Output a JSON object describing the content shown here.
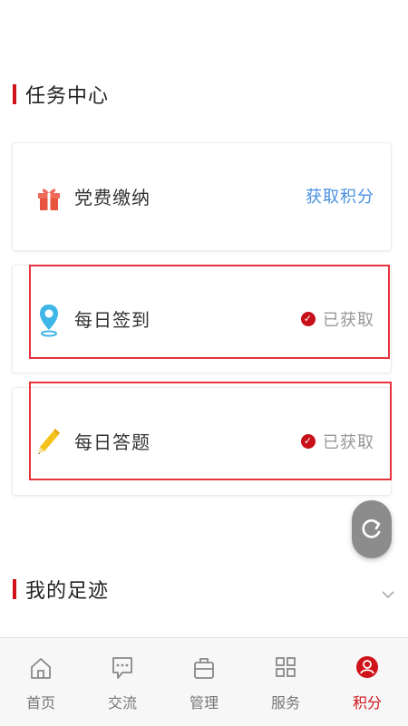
{
  "tasks": {
    "title": "任务中心",
    "items": [
      {
        "label": "党费缴纳",
        "action": "获取积分"
      },
      {
        "label": "每日签到",
        "status": "已获取"
      },
      {
        "label": "每日答题",
        "status": "已获取"
      }
    ]
  },
  "footprint": {
    "title": "我的足迹"
  },
  "tabbar": {
    "items": [
      {
        "label": "首页",
        "icon": "home-icon"
      },
      {
        "label": "交流",
        "icon": "chat-icon"
      },
      {
        "label": "管理",
        "icon": "briefcase-icon"
      },
      {
        "label": "服务",
        "icon": "grid-icon"
      },
      {
        "label": "积分",
        "icon": "points-icon",
        "active": true
      }
    ]
  },
  "colors": {
    "accent": "#d0121b",
    "link": "#4a90e2",
    "highlight": "#e8323c"
  }
}
